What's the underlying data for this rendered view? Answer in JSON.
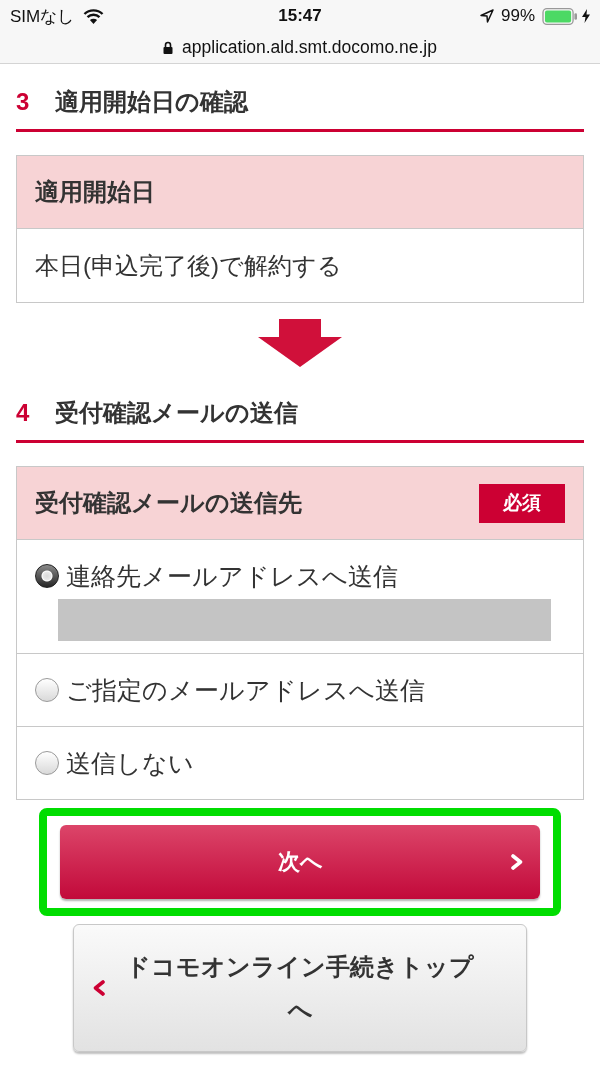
{
  "status_bar": {
    "carrier": "SIMなし",
    "time": "15:47",
    "battery": "99%"
  },
  "address_bar": {
    "url": "application.ald.smt.docomo.ne.jp"
  },
  "sections": [
    {
      "number": "3",
      "title": "適用開始日の確認",
      "card": {
        "header": "適用開始日",
        "rows": [
          {
            "kind": "text",
            "text": "本日(申込完了後)で解約する"
          }
        ]
      }
    },
    {
      "number": "4",
      "title": "受付確認メールの送信",
      "card": {
        "header": "受付確認メールの送信先",
        "badge": "必須",
        "rows": [
          {
            "kind": "radio",
            "label": "連絡先メールアドレスへ送信",
            "selected": true,
            "redacted": true
          },
          {
            "kind": "radio",
            "label": "ご指定のメールアドレスへ送信",
            "selected": false,
            "redacted": false
          },
          {
            "kind": "radio",
            "label": "送信しない",
            "selected": false,
            "redacted": false
          }
        ]
      }
    }
  ],
  "buttons": [
    {
      "kind": "primary",
      "label": "次へ",
      "highlighted": true
    },
    {
      "kind": "secondary",
      "label": "ドコモオンライン手続きトップへ",
      "highlighted": false
    }
  ]
}
